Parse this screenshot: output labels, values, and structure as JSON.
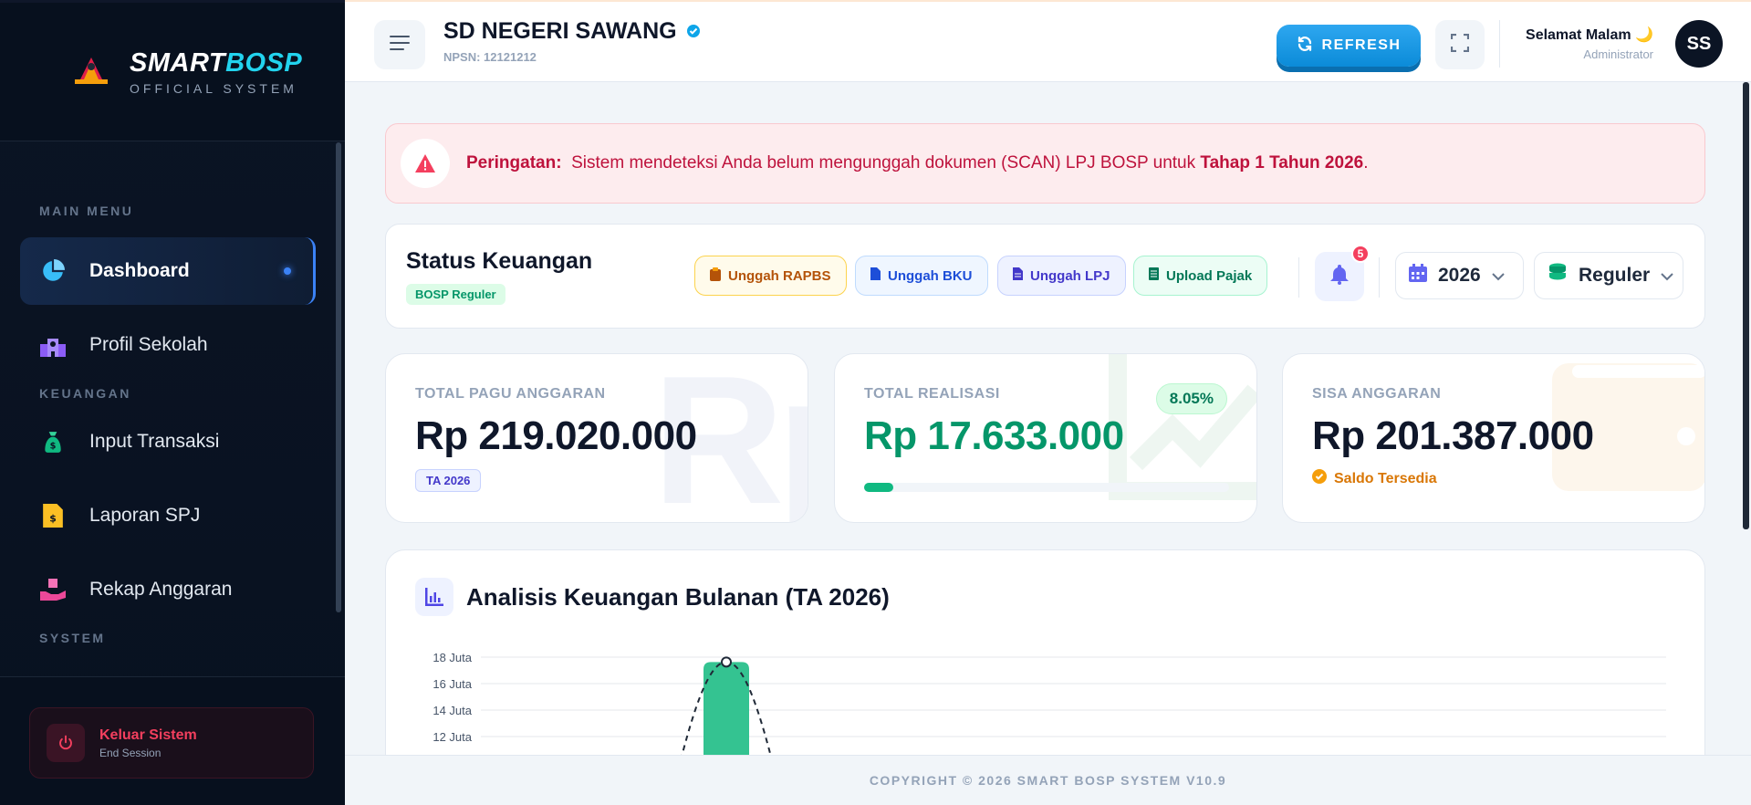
{
  "brand": {
    "title_white": "SMART",
    "title_blue": "BOSP",
    "subtitle": "OFFICIAL SYSTEM",
    "logo_text": "SmartBosp"
  },
  "sidebar": {
    "sections": {
      "main": "MAIN MENU",
      "keuangan": "KEUANGAN",
      "system": "SYSTEM"
    },
    "items": [
      {
        "label": "Dashboard",
        "icon": "pie-chart-icon",
        "active": true
      },
      {
        "label": "Profil Sekolah",
        "icon": "school-icon"
      },
      {
        "label": "Input Transaksi",
        "icon": "money-bag-icon"
      },
      {
        "label": "Laporan SPJ",
        "icon": "invoice-icon"
      },
      {
        "label": "Rekap Anggaran",
        "icon": "hand-holding-box-icon"
      }
    ],
    "logout": {
      "title": "Keluar Sistem",
      "subtitle": "End Session"
    }
  },
  "header": {
    "school_name": "SD NEGERI SAWANG",
    "npsn": "NPSN: 12121212",
    "refresh_label": "REFRESH",
    "greeting": "Selamat Malam 🌙",
    "role": "Administrator",
    "avatar_initials": "SS"
  },
  "alert": {
    "prefix": "Peringatan:",
    "message": "Sistem mendeteksi Anda belum mengunggah dokumen (SCAN) LPJ BOSP untuk ",
    "highlight": "Tahap 1 Tahun 2026",
    "suffix": "."
  },
  "status": {
    "title": "Status Keuangan",
    "tag": "BOSP Reguler",
    "buttons": [
      {
        "label": "Unggah RAPBS",
        "color": "#b45309"
      },
      {
        "label": "Unggah BKU",
        "color": "#1d4ed8"
      },
      {
        "label": "Unggah LPJ",
        "color": "#4338ca"
      },
      {
        "label": "Upload Pajak",
        "color": "#047857"
      }
    ],
    "notif_count": "5",
    "year": "2026",
    "fund_type": "Reguler"
  },
  "cards": {
    "pagu": {
      "label": "TOTAL PAGU ANGGARAN",
      "value": "Rp 219.020.000",
      "tag": "TA 2026",
      "watermark": "Rp"
    },
    "realisasi": {
      "label": "TOTAL REALISASI",
      "value": "Rp 17.633.000",
      "percent": "8.05%",
      "progress": 0.0805
    },
    "sisa": {
      "label": "SISA ANGGARAN",
      "value": "Rp 201.387.000",
      "status": "Saldo Tersedia"
    }
  },
  "chart": {
    "title": "Analisis Keuangan Bulanan (TA 2026)"
  },
  "chart_data": {
    "type": "bar",
    "title": "Analisis Keuangan Bulanan (TA 2026)",
    "y_ticks": [
      "18 Juta",
      "16 Juta",
      "14 Juta",
      "12 Juta"
    ],
    "ylim": [
      12,
      18
    ],
    "y_unit": "Juta",
    "series": [
      {
        "values": [
          17.633
        ],
        "color": "#34c391"
      }
    ],
    "line_peak": 17.633,
    "grid": true
  },
  "footer": {
    "copyright": "COPYRIGHT © 2026 SMART BOSP SYSTEM V10.9"
  }
}
